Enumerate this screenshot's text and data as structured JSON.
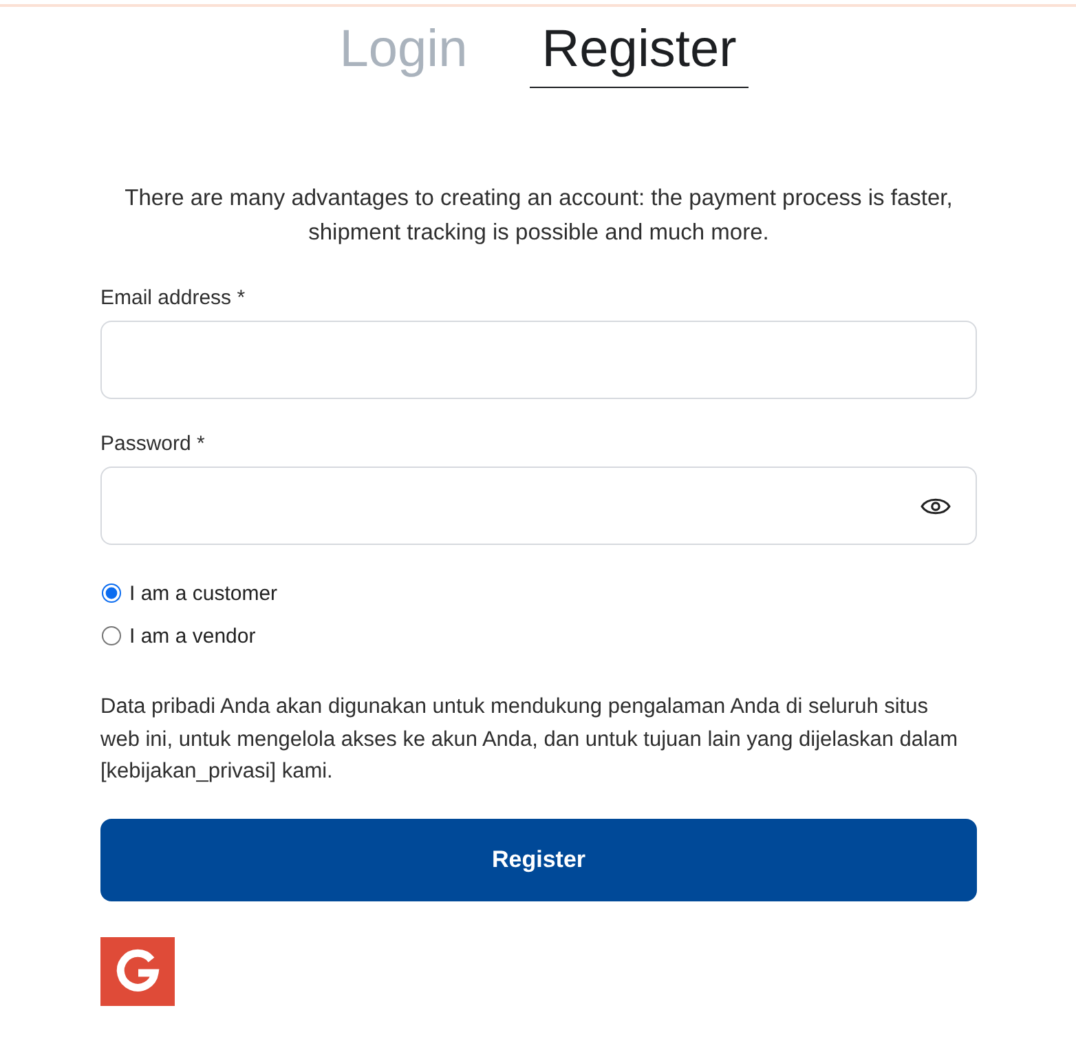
{
  "tabs": [
    {
      "label": "Login",
      "selected": false
    },
    {
      "label": "Register",
      "selected": true
    }
  ],
  "intro": "There are many advantages to creating an account: the payment process is faster, shipment tracking is possible and much more.",
  "fields": [
    {
      "kind": "email",
      "label": "Email address *"
    },
    {
      "kind": "password",
      "label": "Password *"
    }
  ],
  "roles": [
    {
      "label": "I am a customer",
      "selected": true
    },
    {
      "label": "I am a vendor",
      "selected": false
    }
  ],
  "privacy_notice": "Data pribadi Anda akan digunakan untuk mendukung pengalaman Anda di seluruh situs web ini, untuk mengelola akses ke akun Anda, dan untuk tujuan lain yang dijelaskan dalam [kebijakan_privasi] kami.",
  "submit_button": "Register"
}
